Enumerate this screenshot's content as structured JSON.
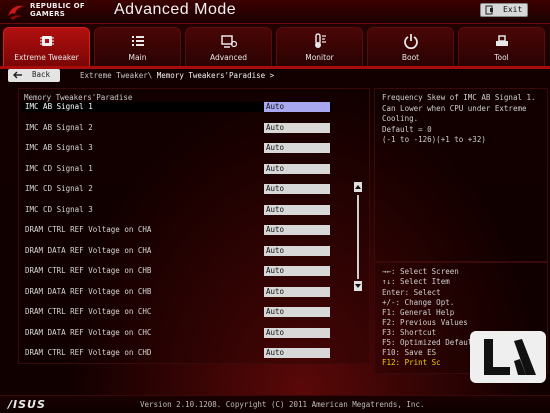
{
  "header": {
    "brand_line1": "REPUBLIC OF",
    "brand_line2": "GAMERS",
    "title": "Advanced Mode",
    "exit_label": "Exit"
  },
  "tabs": [
    {
      "label": "Extreme Tweaker",
      "icon": "cpu-chip-icon",
      "active": true
    },
    {
      "label": "Main",
      "icon": "list-icon",
      "active": false
    },
    {
      "label": "Advanced",
      "icon": "advanced-icon",
      "active": false
    },
    {
      "label": "Monitor",
      "icon": "monitor-icon",
      "active": false
    },
    {
      "label": "Boot",
      "icon": "power-icon",
      "active": false
    },
    {
      "label": "Tool",
      "icon": "tool-icon",
      "active": false
    }
  ],
  "breadcrumb": {
    "back_label": "Back",
    "path": "Extreme Tweaker\\",
    "current": "Memory Tweakers'Paradise >"
  },
  "settings": {
    "section_title": "Memory Tweakers'Paradise",
    "items": [
      {
        "name": "IMC AB Signal 1",
        "value": "Auto"
      },
      {
        "name": "IMC AB Signal 2",
        "value": "Auto"
      },
      {
        "name": "IMC AB Signal 3",
        "value": "Auto"
      },
      {
        "name": "IMC CD Signal 1",
        "value": "Auto"
      },
      {
        "name": "IMC CD Signal 2",
        "value": "Auto"
      },
      {
        "name": "IMC CD Signal 3",
        "value": "Auto"
      },
      {
        "name": "DRAM CTRL REF Voltage on CHA",
        "value": "Auto"
      },
      {
        "name": "DRAM DATA REF Voltage on CHA",
        "value": "Auto"
      },
      {
        "name": "DRAM CTRL REF Voltage on CHB",
        "value": "Auto"
      },
      {
        "name": "DRAM DATA REF Voltage on CHB",
        "value": "Auto"
      },
      {
        "name": "DRAM CTRL REF Voltage on CHC",
        "value": "Auto"
      },
      {
        "name": "DRAM DATA REF Voltage on CHC",
        "value": "Auto"
      },
      {
        "name": "DRAM CTRL REF Voltage on CHD",
        "value": "Auto"
      }
    ]
  },
  "help": {
    "lines": [
      "Frequency Skew of IMC AB Signal 1.",
      "Can Lower when CPU under Extreme",
      "Cooling.",
      "Default = 0",
      "(-1 to -126)(+1 to +32)"
    ]
  },
  "keys": [
    {
      "text": "→←: Select Screen",
      "highlight": false
    },
    {
      "text": "↑↓: Select Item",
      "highlight": false
    },
    {
      "text": "Enter: Select",
      "highlight": false
    },
    {
      "text": "+/-: Change Opt.",
      "highlight": false
    },
    {
      "text": "F1: General Help",
      "highlight": false
    },
    {
      "text": "F2: Previous Values",
      "highlight": false
    },
    {
      "text": "F3: Shortcut",
      "highlight": false
    },
    {
      "text": "F5: Optimized Defaults",
      "highlight": false
    },
    {
      "text": "F10: Save  ES",
      "highlight": false
    },
    {
      "text": "F12: Print Sc",
      "highlight": true
    }
  ],
  "footer": {
    "brand": "/ISUS",
    "version": "Version 2.10.1208. Copyright (C) 2011 American Megatrends, Inc."
  },
  "colors": {
    "accent": "#a80c0c",
    "highlight_text": "#f0d000",
    "selected_value_bg": "#a8a8f0"
  }
}
